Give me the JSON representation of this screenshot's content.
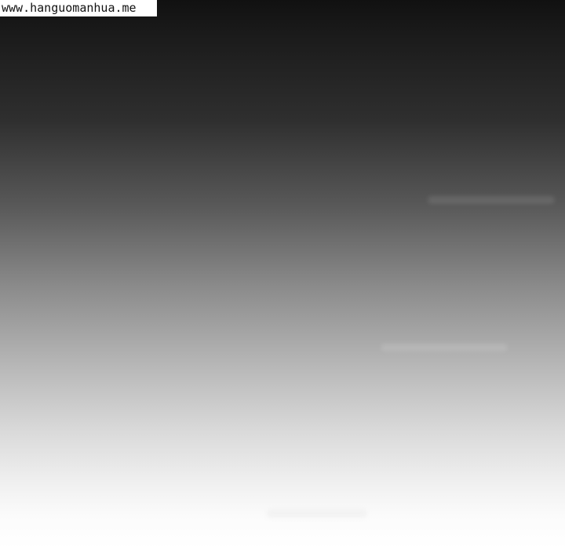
{
  "watermark": {
    "text": "www.hanguomanhua.me"
  },
  "colors": {
    "gradient_top": "#111111",
    "gradient_bottom": "#ffffff",
    "watermark_background": "#ffffff",
    "watermark_text": "#111111"
  }
}
